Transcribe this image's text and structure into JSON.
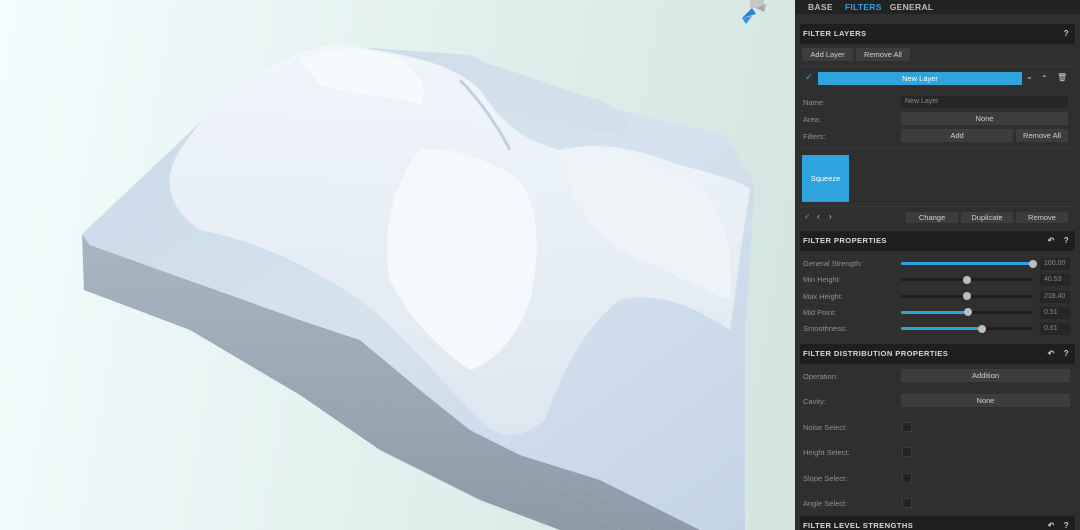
{
  "tabs": [
    {
      "label": "BASE"
    },
    {
      "label": "FILTERS"
    },
    {
      "label": "GENERAL"
    }
  ],
  "filter_layers": {
    "header": "FILTER LAYERS",
    "help": "?",
    "add_layer": "Add Layer",
    "remove_all": "Remove All",
    "layer_title": "New Layer",
    "name_label": "Name:",
    "name_value": "New Layer",
    "area_label": "Area:",
    "area_value": "None",
    "filters_label": "Filters:",
    "filters_add": "Add",
    "filters_remove_all": "Remove All",
    "filter_tile": "Squeeze",
    "change": "Change",
    "duplicate": "Duplicate",
    "remove": "Remove"
  },
  "filter_properties": {
    "header": "FILTER PROPERTIES",
    "help": "?",
    "sliders": [
      {
        "label": "General Strength:",
        "value": "100.00",
        "fraction": 1.0,
        "filled": true
      },
      {
        "label": "Min Height:",
        "value": "40.53",
        "fraction": 0.5,
        "filled": false
      },
      {
        "label": "Max Height:",
        "value": "218.40",
        "fraction": 0.5,
        "filled": false
      },
      {
        "label": "Mid Point:",
        "value": "0.51",
        "fraction": 0.51,
        "filled": true
      },
      {
        "label": "Smoothness:",
        "value": "0.61",
        "fraction": 0.61,
        "filled": true
      }
    ]
  },
  "distribution": {
    "header": "FILTER DISTRIBUTION PROPERTIES",
    "help": "?",
    "operation_label": "Operation:",
    "operation_value": "Addition",
    "cavity_label": "Cavity:",
    "cavity_value": "None",
    "checks": [
      {
        "label": "Noise Select:"
      },
      {
        "label": "Height Select:"
      },
      {
        "label": "Slope Select:"
      },
      {
        "label": "Angle Select:"
      }
    ]
  },
  "level_strengths": {
    "header": "FILTER LEVEL STRENGTHS",
    "help": "?"
  },
  "colors": {
    "accent": "#2fa3dd",
    "panel_bg": "#2f2f2f",
    "header_bg": "#1f1f1f",
    "button_bg": "#3d3d3d"
  }
}
